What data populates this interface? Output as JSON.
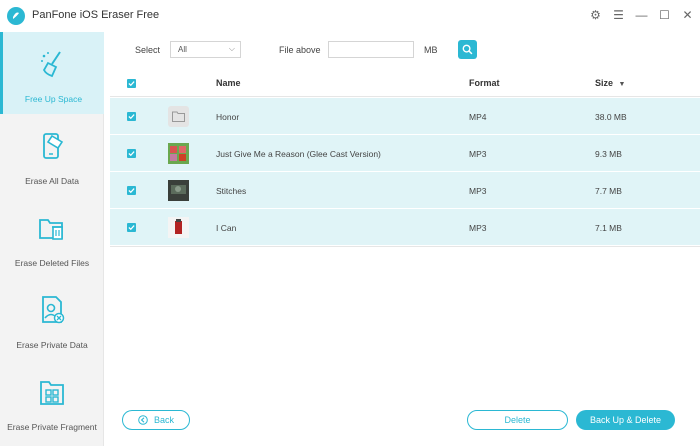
{
  "app": {
    "title": "PanFone iOS Eraser Free"
  },
  "window_controls": {
    "settings": "⚙",
    "menu": "☰",
    "minimize": "—",
    "maximize": "☐",
    "close": "✕"
  },
  "sidebar": {
    "items": [
      {
        "label": "Free Up Space",
        "icon": "broom-icon",
        "active": true
      },
      {
        "label": "Erase All Data",
        "icon": "phone-erase-icon",
        "active": false
      },
      {
        "label": "Erase Deleted Files",
        "icon": "folder-trash-icon",
        "active": false
      },
      {
        "label": "Erase Private Data",
        "icon": "private-file-icon",
        "active": false
      },
      {
        "label": "Erase Private Fragment",
        "icon": "fragment-grid-icon",
        "active": false
      }
    ]
  },
  "filter": {
    "select_label": "Select",
    "select_value": "All",
    "file_above_label": "File above",
    "size_value": "",
    "unit": "MB"
  },
  "table": {
    "columns": {
      "name": "Name",
      "format": "Format",
      "size": "Size",
      "size_sort": "▼"
    },
    "rows": [
      {
        "name": "Honor",
        "format": "MP4",
        "size": "38.0 MB",
        "thumb": "folder-icon",
        "checked": true
      },
      {
        "name": "Just Give Me a Reason (Glee Cast Version)",
        "format": "MP3",
        "size": "9.3 MB",
        "thumb": "album-art-icon",
        "checked": true
      },
      {
        "name": "Stitches",
        "format": "MP3",
        "size": "7.7 MB",
        "thumb": "album-art-icon",
        "checked": true
      },
      {
        "name": "I Can",
        "format": "MP3",
        "size": "7.1 MB",
        "thumb": "album-art-icon",
        "checked": true
      }
    ]
  },
  "buttons": {
    "back": "Back",
    "delete": "Delete",
    "backup_delete": "Back Up & Delete"
  },
  "colors": {
    "accent": "#2bb8d3",
    "row_bg": "#e0f4f7",
    "sidebar_bg": "#f3f3f3"
  }
}
